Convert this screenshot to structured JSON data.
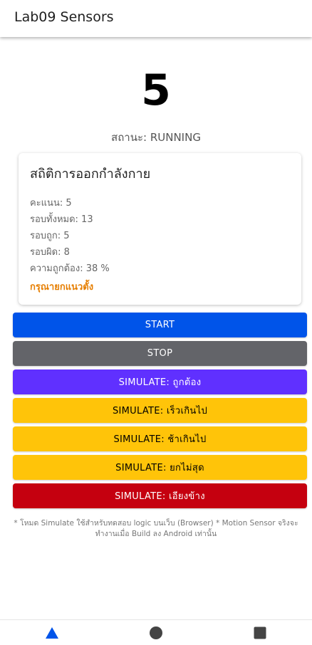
{
  "app_bar": {
    "title": "Lab09 Sensors"
  },
  "counter": {
    "value": "5"
  },
  "status": {
    "text": "สถานะ: RUNNING"
  },
  "stats_card": {
    "title": "สถิติการออกกำลังกาย",
    "lines": [
      "คะแนน: 5",
      "รอบทั้งหมด: 13",
      "รอบถูก: 5",
      "รอบผิด: 8",
      "ความถูกต้อง: 38 %"
    ],
    "warning": "กรุณายกแนวตั้ง",
    "warning_color": "#e67e00"
  },
  "buttons": {
    "start": {
      "label": "START",
      "color": "#0054e9"
    },
    "stop": {
      "label": "STOP",
      "color": "#636469"
    },
    "simulate_correct": {
      "label": "SIMULATE: ถูกต้อง",
      "color": "#6030ff"
    },
    "simulate_too_fast": {
      "label": "SIMULATE: เร็วเกินไป",
      "color": "#ffc409"
    },
    "simulate_too_slow": {
      "label": "SIMULATE: ช้าเกินไป",
      "color": "#ffc409"
    },
    "simulate_not_full": {
      "label": "SIMULATE: ยกไม่สุด",
      "color": "#ffc409"
    },
    "simulate_tilted": {
      "label": "SIMULATE: เอียงข้าง",
      "color": "#c5000f"
    }
  },
  "footnote": "* โหมด Simulate ใช้สำหรับทดสอบ logic บนเว็บ (Browser) * Motion Sensor จริงจะทำงานเมื่อ Build ลง Android เท่านั้น",
  "tabs": [
    {
      "icon": "triangle-icon",
      "color": "#0054e9"
    },
    {
      "icon": "circle-icon",
      "color": "#444444"
    },
    {
      "icon": "square-icon",
      "color": "#444444"
    }
  ]
}
